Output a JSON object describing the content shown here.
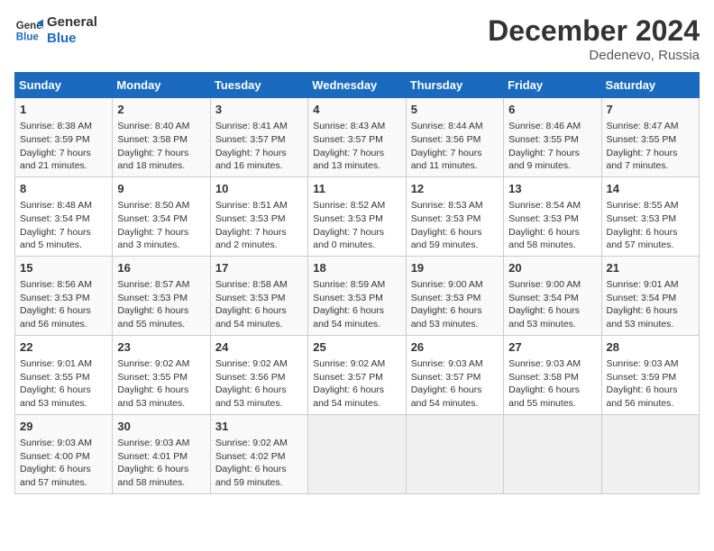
{
  "header": {
    "logo_line1": "General",
    "logo_line2": "Blue",
    "month": "December 2024",
    "location": "Dedenevo, Russia"
  },
  "days_of_week": [
    "Sunday",
    "Monday",
    "Tuesday",
    "Wednesday",
    "Thursday",
    "Friday",
    "Saturday"
  ],
  "weeks": [
    [
      {
        "num": "1",
        "sunrise": "8:38 AM",
        "sunset": "3:59 PM",
        "daylight": "7 hours and 21 minutes."
      },
      {
        "num": "2",
        "sunrise": "8:40 AM",
        "sunset": "3:58 PM",
        "daylight": "7 hours and 18 minutes."
      },
      {
        "num": "3",
        "sunrise": "8:41 AM",
        "sunset": "3:57 PM",
        "daylight": "7 hours and 16 minutes."
      },
      {
        "num": "4",
        "sunrise": "8:43 AM",
        "sunset": "3:57 PM",
        "daylight": "7 hours and 13 minutes."
      },
      {
        "num": "5",
        "sunrise": "8:44 AM",
        "sunset": "3:56 PM",
        "daylight": "7 hours and 11 minutes."
      },
      {
        "num": "6",
        "sunrise": "8:46 AM",
        "sunset": "3:55 PM",
        "daylight": "7 hours and 9 minutes."
      },
      {
        "num": "7",
        "sunrise": "8:47 AM",
        "sunset": "3:55 PM",
        "daylight": "7 hours and 7 minutes."
      }
    ],
    [
      {
        "num": "8",
        "sunrise": "8:48 AM",
        "sunset": "3:54 PM",
        "daylight": "7 hours and 5 minutes."
      },
      {
        "num": "9",
        "sunrise": "8:50 AM",
        "sunset": "3:54 PM",
        "daylight": "7 hours and 3 minutes."
      },
      {
        "num": "10",
        "sunrise": "8:51 AM",
        "sunset": "3:53 PM",
        "daylight": "7 hours and 2 minutes."
      },
      {
        "num": "11",
        "sunrise": "8:52 AM",
        "sunset": "3:53 PM",
        "daylight": "7 hours and 0 minutes."
      },
      {
        "num": "12",
        "sunrise": "8:53 AM",
        "sunset": "3:53 PM",
        "daylight": "6 hours and 59 minutes."
      },
      {
        "num": "13",
        "sunrise": "8:54 AM",
        "sunset": "3:53 PM",
        "daylight": "6 hours and 58 minutes."
      },
      {
        "num": "14",
        "sunrise": "8:55 AM",
        "sunset": "3:53 PM",
        "daylight": "6 hours and 57 minutes."
      }
    ],
    [
      {
        "num": "15",
        "sunrise": "8:56 AM",
        "sunset": "3:53 PM",
        "daylight": "6 hours and 56 minutes."
      },
      {
        "num": "16",
        "sunrise": "8:57 AM",
        "sunset": "3:53 PM",
        "daylight": "6 hours and 55 minutes."
      },
      {
        "num": "17",
        "sunrise": "8:58 AM",
        "sunset": "3:53 PM",
        "daylight": "6 hours and 54 minutes."
      },
      {
        "num": "18",
        "sunrise": "8:59 AM",
        "sunset": "3:53 PM",
        "daylight": "6 hours and 54 minutes."
      },
      {
        "num": "19",
        "sunrise": "9:00 AM",
        "sunset": "3:53 PM",
        "daylight": "6 hours and 53 minutes."
      },
      {
        "num": "20",
        "sunrise": "9:00 AM",
        "sunset": "3:54 PM",
        "daylight": "6 hours and 53 minutes."
      },
      {
        "num": "21",
        "sunrise": "9:01 AM",
        "sunset": "3:54 PM",
        "daylight": "6 hours and 53 minutes."
      }
    ],
    [
      {
        "num": "22",
        "sunrise": "9:01 AM",
        "sunset": "3:55 PM",
        "daylight": "6 hours and 53 minutes."
      },
      {
        "num": "23",
        "sunrise": "9:02 AM",
        "sunset": "3:55 PM",
        "daylight": "6 hours and 53 minutes."
      },
      {
        "num": "24",
        "sunrise": "9:02 AM",
        "sunset": "3:56 PM",
        "daylight": "6 hours and 53 minutes."
      },
      {
        "num": "25",
        "sunrise": "9:02 AM",
        "sunset": "3:57 PM",
        "daylight": "6 hours and 54 minutes."
      },
      {
        "num": "26",
        "sunrise": "9:03 AM",
        "sunset": "3:57 PM",
        "daylight": "6 hours and 54 minutes."
      },
      {
        "num": "27",
        "sunrise": "9:03 AM",
        "sunset": "3:58 PM",
        "daylight": "6 hours and 55 minutes."
      },
      {
        "num": "28",
        "sunrise": "9:03 AM",
        "sunset": "3:59 PM",
        "daylight": "6 hours and 56 minutes."
      }
    ],
    [
      {
        "num": "29",
        "sunrise": "9:03 AM",
        "sunset": "4:00 PM",
        "daylight": "6 hours and 57 minutes."
      },
      {
        "num": "30",
        "sunrise": "9:03 AM",
        "sunset": "4:01 PM",
        "daylight": "6 hours and 58 minutes."
      },
      {
        "num": "31",
        "sunrise": "9:02 AM",
        "sunset": "4:02 PM",
        "daylight": "6 hours and 59 minutes."
      },
      null,
      null,
      null,
      null
    ]
  ]
}
